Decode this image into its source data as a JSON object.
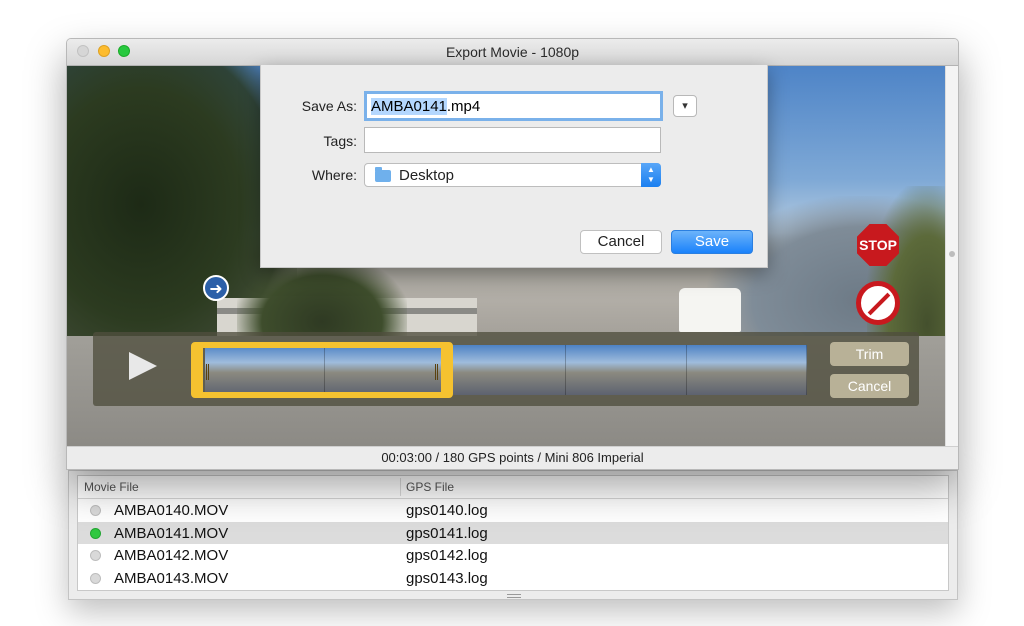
{
  "window": {
    "title": "Export Movie - 1080p"
  },
  "save_dialog": {
    "save_as_label": "Save As:",
    "filename_selected": "AMBA0141",
    "filename_ext": ".mp4",
    "tags_label": "Tags:",
    "tags_value": "",
    "where_label": "Where:",
    "where_value": "Desktop",
    "cancel_label": "Cancel",
    "save_label": "Save",
    "disclosure_icon": "chevron-down-icon"
  },
  "video": {
    "signs": {
      "stop": "STOP"
    }
  },
  "trimmer": {
    "trim_label": "Trim",
    "cancel_label": "Cancel"
  },
  "status": {
    "text": "00:03:00 / 180 GPS points / Mini 806 Imperial"
  },
  "file_list": {
    "columns": [
      "Movie File",
      "GPS File"
    ],
    "rows": [
      {
        "movie": "AMBA0140.MOV",
        "gps": "gps0140.log",
        "active": false
      },
      {
        "movie": "AMBA0141.MOV",
        "gps": "gps0141.log",
        "active": true
      },
      {
        "movie": "AMBA0142.MOV",
        "gps": "gps0142.log",
        "active": false
      },
      {
        "movie": "AMBA0143.MOV",
        "gps": "gps0143.log",
        "active": false
      }
    ]
  },
  "colors": {
    "accent": "#1a82fb",
    "trim_selection": "#f5c230",
    "status_active": "#2fc840"
  }
}
